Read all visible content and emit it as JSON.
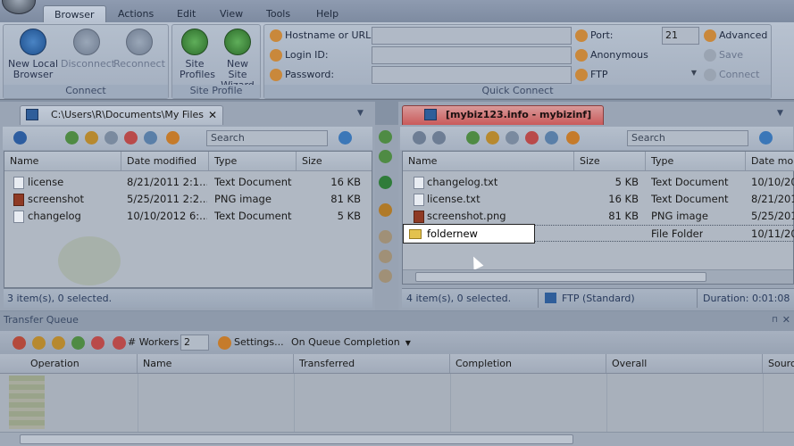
{
  "menu": {
    "tabs": [
      "Browser",
      "Actions",
      "Edit",
      "View",
      "Tools",
      "Help"
    ],
    "active": "Browser"
  },
  "ribbon": {
    "connect": {
      "caption": "Connect",
      "buttons": [
        {
          "label": "New Local Browser",
          "enabled": true
        },
        {
          "label": "Disconnect",
          "enabled": false
        },
        {
          "label": "Reconnect",
          "enabled": false
        }
      ]
    },
    "site_profile": {
      "caption": "Site Profile",
      "buttons": [
        {
          "label": "Site Profiles"
        },
        {
          "label": "New Site Wizard"
        }
      ]
    },
    "quick_connect": {
      "caption": "Quick Connect",
      "hostname_label": "Hostname or URL:",
      "login_label": "Login ID:",
      "password_label": "Password:",
      "port_label": "Port:",
      "port_value": "21",
      "anonymous_label": "Anonymous",
      "protocol_value": "FTP",
      "advanced_label": "Advanced",
      "save_label": "Save",
      "connect_label": "Connect"
    }
  },
  "local": {
    "tab_title": "C:\\Users\\R\\Documents\\My Files",
    "search_placeholder": "Search",
    "columns": [
      "Name",
      "Date modified",
      "Type",
      "Size"
    ],
    "rows": [
      {
        "name": "license",
        "date": "8/21/2011 2:1...",
        "type": "Text Document",
        "size": "16 KB",
        "icon": "text-file"
      },
      {
        "name": "screenshot",
        "date": "5/25/2011 2:2...",
        "type": "PNG image",
        "size": "81 KB",
        "icon": "image-file"
      },
      {
        "name": "changelog",
        "date": "10/10/2012 6:...",
        "type": "Text Document",
        "size": "5 KB",
        "icon": "text-file"
      }
    ],
    "status": "3 item(s), 0 selected."
  },
  "remote": {
    "tab_title": "[mybiz123.info - mybizinf] ...",
    "search_placeholder": "Search",
    "columns": [
      "Name",
      "Size",
      "Type",
      "Date mo"
    ],
    "rows": [
      {
        "name": "changelog.txt",
        "size": "5 KB",
        "type": "Text Document",
        "date": "10/10/20",
        "icon": "text-file"
      },
      {
        "name": "license.txt",
        "size": "16 KB",
        "type": "Text Document",
        "date": "8/21/201",
        "icon": "text-file"
      },
      {
        "name": "screenshot.png",
        "size": "81 KB",
        "type": "PNG image",
        "date": "5/25/201",
        "icon": "image-file"
      },
      {
        "name": "foldernew",
        "size": "",
        "type": "File Folder",
        "date": "10/11/20",
        "icon": "folder",
        "editing": true
      }
    ],
    "status": "4 item(s), 0 selected.",
    "connection": "FTP (Standard)",
    "duration": "Duration: 0:01:08"
  },
  "queue": {
    "title": "Transfer Queue",
    "workers_label": "# Workers",
    "workers_value": "2",
    "settings_label": "Settings...",
    "completion_label": "On Queue Completion",
    "columns": [
      "Operation",
      "Name",
      "Transferred",
      "Completion",
      "Overall",
      "Sourc"
    ]
  },
  "colors": {
    "accent": "#3b6fb6",
    "remote_tab": "#c95a5a",
    "overlay": "#8592a4"
  }
}
